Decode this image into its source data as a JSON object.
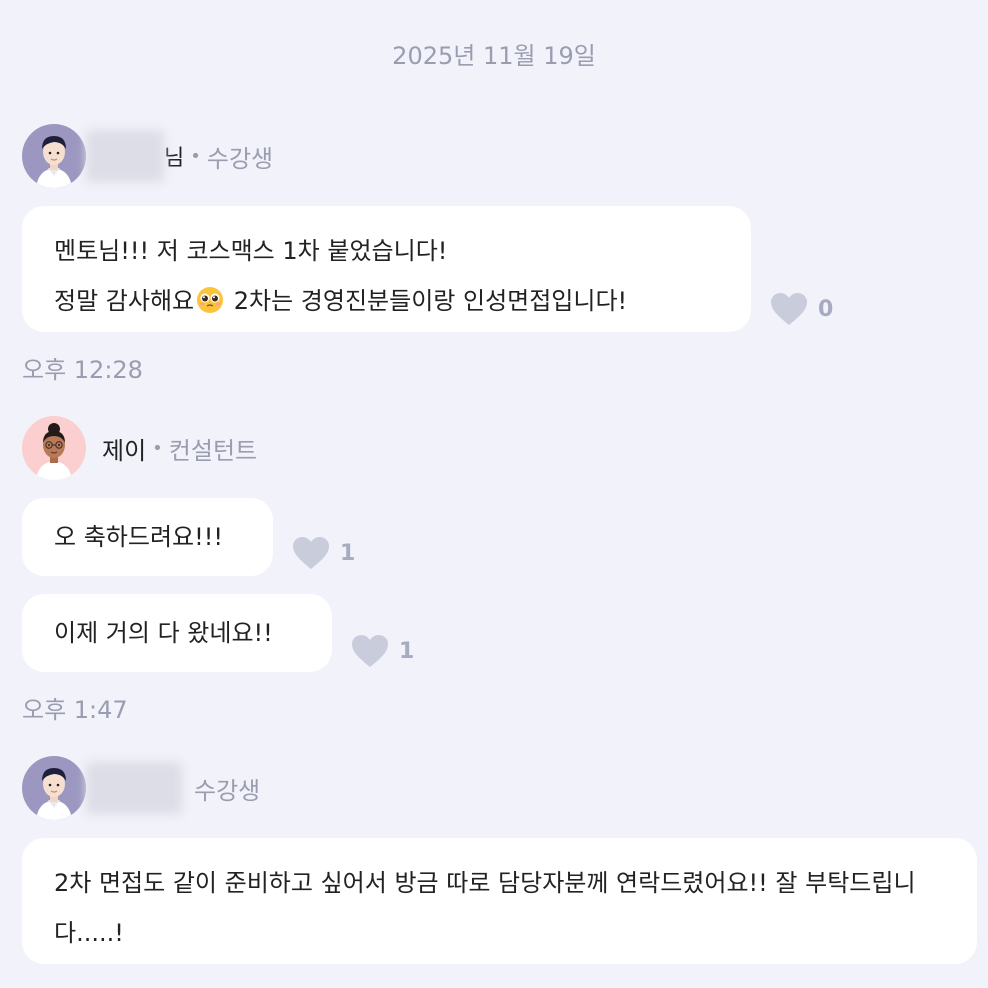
{
  "date_separator": "2025년 11월 19일",
  "messages": [
    {
      "sender_name_visible": "님",
      "role": "수강생",
      "text_line1": "멘토님!!! 저 코스맥스 1차 붙었습니다!",
      "text_line2a": "정말 감사해요",
      "emoji": "pleading-face",
      "text_line2b": " 2차는 경영진분들이랑 인성면접입니다!",
      "likes": "0",
      "time": "오후 12:28"
    },
    {
      "sender_name": "제이",
      "role": "컨설턴트",
      "bubbles": [
        {
          "text": "오 축하드려요!!!",
          "likes": "1"
        },
        {
          "text": "이제 거의 다 왔네요!!",
          "likes": "1"
        }
      ],
      "time": "오후 1:47"
    },
    {
      "role": "수강생",
      "text": "2차 면접도 같이 준비하고 싶어서 방금 따로 담당자분께 연락드렸어요!! 잘 부탁드립니다.....!"
    }
  ],
  "colors": {
    "background": "#f2f2fa",
    "bubble": "#ffffff",
    "muted_text": "#9a9cb0",
    "heart": "#c9cddb"
  },
  "icons": {
    "like": "heart-icon",
    "avatar_student": "student-avatar",
    "avatar_consultant": "consultant-avatar"
  }
}
